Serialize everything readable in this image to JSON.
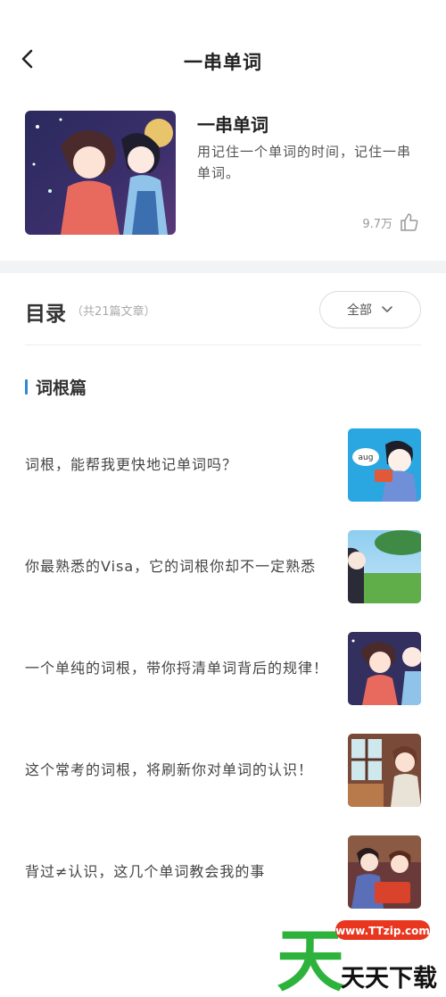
{
  "header": {
    "title": "一串单词"
  },
  "book": {
    "title": "一串单词",
    "description": "用记住一个单词的时间，记住一串单词。",
    "likes": "9.7万"
  },
  "toc": {
    "title": "目录",
    "count": "（共21篇文章）",
    "filter_label": "全部"
  },
  "section": {
    "label": "词根篇"
  },
  "articles": [
    {
      "title": "词根，能帮我更快地记单词吗？"
    },
    {
      "title": "你最熟悉的Visa，它的词根你却不一定熟悉"
    },
    {
      "title": "一个单纯的词根，带你捋清单词背后的规律！"
    },
    {
      "title": "这个常考的词根，将刷新你对单词的认识！"
    },
    {
      "title": "背过≠认识，这几个单词教会我的事"
    }
  ],
  "thumb_badge": "aug",
  "watermark": {
    "brand": "天天下载",
    "url": "www.TTzip.com"
  },
  "colors": {
    "accent": "#2f88d6",
    "watermark_green": "#2db33b",
    "watermark_red": "#e8361f"
  }
}
